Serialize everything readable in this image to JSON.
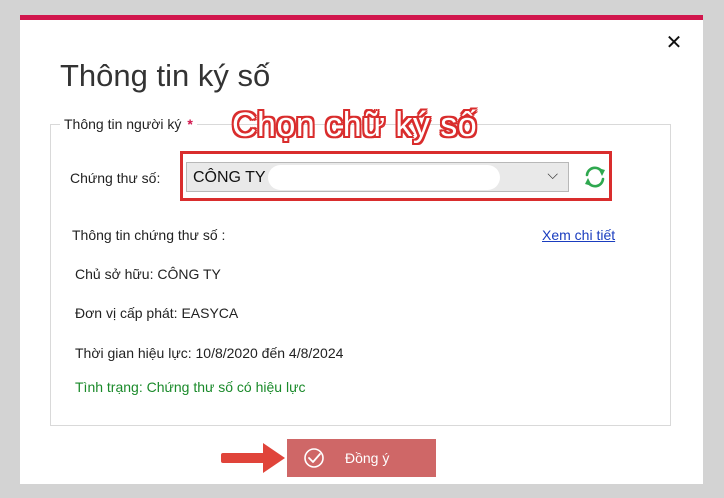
{
  "dialog": {
    "title": "Thông tin ký số",
    "close_icon": "close-icon"
  },
  "signer_group": {
    "legend": "Thông tin người ký",
    "required_mark": "*"
  },
  "annotation": "Chọn chữ ký số",
  "certificate": {
    "label": "Chứng thư số:",
    "selected_value": "CÔNG TY",
    "refresh_icon": "refresh-icon"
  },
  "info": {
    "heading": "Thông tin chứng thư số :",
    "detail_link": "Xem chi tiết",
    "owner": "Chủ sở hữu: CÔNG TY",
    "issuer": "Đơn vị cấp phát: EASYCA",
    "validity": "Thời gian hiệu lực: 10/8/2020 đến 4/8/2024",
    "status": "Tình trạng: Chứng thư số có hiệu lực"
  },
  "actions": {
    "ok_label": "Đồng ý"
  },
  "colors": {
    "accent": "#d1164d",
    "annotation_red": "#d92d2d",
    "status_green": "#1a8a2a",
    "link_blue": "#1a3dbf",
    "button_bg": "#cf6767"
  }
}
